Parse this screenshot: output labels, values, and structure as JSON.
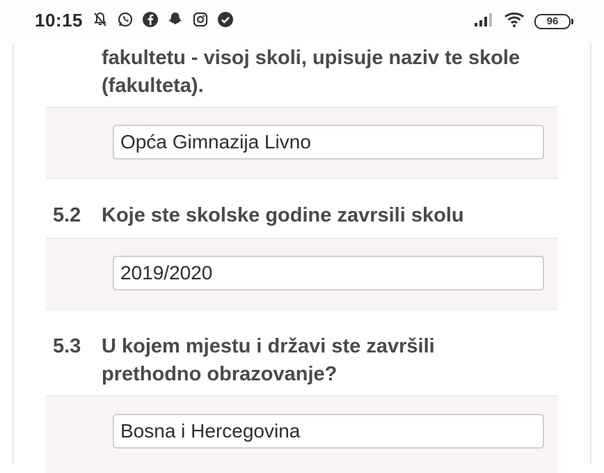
{
  "status_bar": {
    "time": "10:15",
    "battery": "96",
    "left_icons": [
      "notifications-off-icon",
      "whatsapp-icon",
      "facebook-icon",
      "snapchat-icon",
      "instagram-icon",
      "check-circle-icon"
    ],
    "right_icons": [
      "signal-icon",
      "wifi-icon",
      "battery-icon"
    ]
  },
  "form": {
    "intro_line_1": "fakultetu - visoj skoli, upisuje naziv te skole",
    "intro_line_2": "(fakulteta).",
    "answer_school": "Opća Gimnazija Livno",
    "q52": {
      "number": "5.2",
      "text": "Koje ste skolske godine zavrsili skolu",
      "answer": "2019/2020"
    },
    "q53": {
      "number": "5.3",
      "text_line_1": "U kojem mjestu i državi ste završili",
      "text_line_2": "prethodno obrazovanje?",
      "answer": "Bosna i Hercegovina"
    }
  },
  "colors": {
    "panel_bg": "#f9f4f4",
    "text": "#4a4a4a",
    "input_border": "#cfcfcf"
  }
}
